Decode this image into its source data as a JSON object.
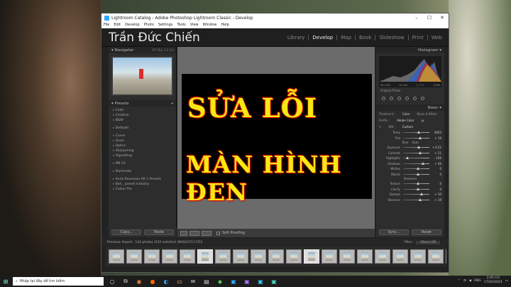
{
  "window": {
    "title": "Lightroom Catalog - Adobe Photoshop Lightroom Classic - Develop",
    "menu": [
      "File",
      "Edit",
      "Develop",
      "Photo",
      "Settings",
      "Tools",
      "View",
      "Window",
      "Help"
    ]
  },
  "identity_plate": "Trần Đức Chiến",
  "modules": [
    "Library",
    "Develop",
    "Map",
    "Book",
    "Slideshow",
    "Print",
    "Web"
  ],
  "left_panel": {
    "navigator": "Navigator",
    "nav_zoom": "FIT  FILL  1:1  3:1",
    "presets_title": "Presets",
    "presets": [
      "Color",
      "Creative",
      "B&W"
    ],
    "presets2": [
      "Defaults"
    ],
    "presets3": [
      "Curve",
      "Grain",
      "Optics",
      "Sharpening",
      "Vignetting"
    ],
    "presets4": [
      "PM V3"
    ],
    "presets5": [
      "Illuminate"
    ],
    "presets6": [
      "Anna Rousseau AR 1 Presets",
      "Bali _ preset industry",
      "Colour Pro"
    ],
    "copy_button": "Copy...",
    "paste_button": "Paste"
  },
  "image_text": {
    "line1": "SỬA LỖI",
    "line2": "MÀN HÌNH ĐEN"
  },
  "toolbar": {
    "soft_proofing": "Soft Proofing"
  },
  "right_panel": {
    "histogram_title": "Histogram",
    "histogram_info": [
      "ISO 200",
      "31 mm",
      "ƒ / 7.1",
      "1/160"
    ],
    "original_photo": "Original Photo",
    "basic_title": "Basic",
    "treatment_label": "Treatment :",
    "treatment_color": "Color",
    "treatment_bw": "Black & White",
    "profile_label": "Profile :",
    "profile_value": "Adobe Color",
    "wb_label": "WB :",
    "wb_value": "Custom",
    "sliders": [
      {
        "label": "Temp",
        "value": "4050"
      },
      {
        "label": "Tint",
        "value": "+ 19"
      },
      {
        "label": "Exposure",
        "value": "+ 0.22"
      },
      {
        "label": "Contrast",
        "value": "+ 21"
      },
      {
        "label": "Highlights",
        "value": "- 100"
      },
      {
        "label": "Shadows",
        "value": "+ 46"
      },
      {
        "label": "Whites",
        "value": "0"
      },
      {
        "label": "Blacks",
        "value": "0"
      },
      {
        "label": "Texture",
        "value": "0"
      },
      {
        "label": "Clarity",
        "value": "0"
      },
      {
        "label": "Dehaze",
        "value": "+ 30"
      },
      {
        "label": "Vibrance",
        "value": "+ 19"
      }
    ],
    "tone_label": "Tone",
    "tone_auto": "Auto",
    "presence_label": "Presence",
    "sync_button": "Sync...",
    "reset_button": "Reset"
  },
  "filmstrip": {
    "source": "Previous Import",
    "count": "142 photos /142 selected",
    "file": "/8A4A2717.CR3",
    "filter_label": "Filter :",
    "filter_value": "Filters Off"
  },
  "taskbar": {
    "search_placeholder": "Nhập tại đây để tìm kiếm",
    "lang": "ENG",
    "time": "2:05 CH",
    "date": "17/02/2021"
  },
  "slider_positions": [
    0.55,
    0.6,
    0.55,
    0.6,
    0.1,
    0.7,
    0.5,
    0.5,
    0.5,
    0.5,
    0.65,
    0.6
  ]
}
